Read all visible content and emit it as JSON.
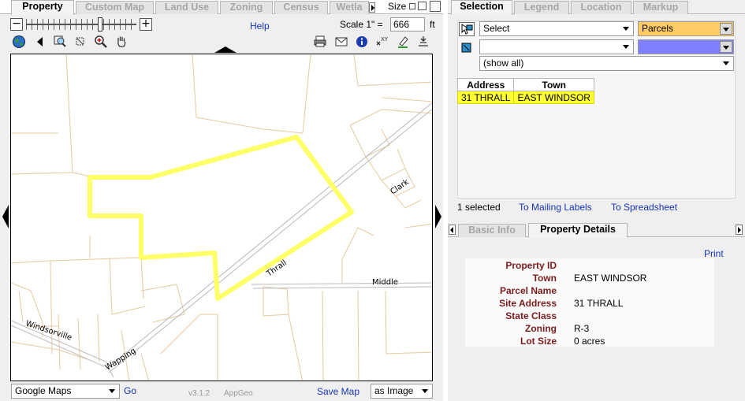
{
  "left_tabs": [
    "Property",
    "Custom Map",
    "Land Use",
    "Zoning",
    "Census",
    "Wetla"
  ],
  "size_label": "Size",
  "help_label": "Help",
  "scale": {
    "label": "Scale 1\" =",
    "value": "666",
    "unit": "ft"
  },
  "map_labels": {
    "clark": "Clark",
    "thrall": "Thrall",
    "middle": "Middle",
    "windsorville": "Windsorville",
    "wapping": "Wapping"
  },
  "basemap_select": "Google Maps",
  "go_label": "Go",
  "version_label": "v3.1.2",
  "appgeo_label": "AppGeo",
  "save_map_label": "Save Map",
  "save_format": "as Image",
  "right_tabs": [
    "Selection",
    "Legend",
    "Location",
    "Markup"
  ],
  "selection": {
    "tool_select": "Select",
    "layer_select": "Parcels",
    "target_select": "",
    "filter_select": "(show all)",
    "columns": [
      "Address",
      "Town"
    ],
    "rows": [
      [
        "31 THRALL",
        "EAST WINDSOR"
      ]
    ],
    "count_text": "1 selected",
    "mailing_labels": "To Mailing Labels",
    "spreadsheet": "To Spreadsheet"
  },
  "info_tabs": [
    "Basic Info",
    "Property Details"
  ],
  "print_label": "Print",
  "details": [
    {
      "label": "Property ID",
      "value": ""
    },
    {
      "label": "Town",
      "value": "EAST WINDSOR"
    },
    {
      "label": "Parcel Name",
      "value": ""
    },
    {
      "label": "Site Address",
      "value": "31 THRALL"
    },
    {
      "label": "State Class",
      "value": ""
    },
    {
      "label": "Zoning",
      "value": "R-3"
    },
    {
      "label": "Lot Size",
      "value": "0 acres"
    }
  ],
  "colors": {
    "parcel_highlight": "#ffff66",
    "parcel_lines": "#e7c9a0",
    "layer_select_bg": "#ffcc66",
    "target_select_bg": "#8080ff",
    "link": "#1733b8"
  }
}
